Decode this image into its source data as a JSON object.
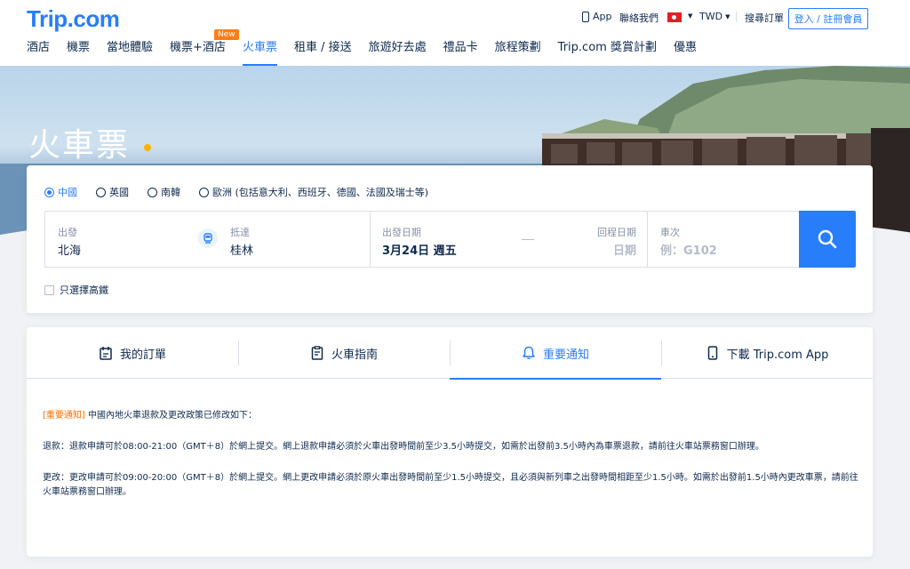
{
  "header": {
    "logo": "Trip.com",
    "app_label": "App",
    "contact_label": "聯絡我們",
    "currency": "TWD",
    "orders_label": "搜尋訂單",
    "login_label": "登入 / 註冊會員"
  },
  "nav": {
    "items": [
      "酒店",
      "機票",
      "當地體驗",
      "機票+酒店",
      "火車票",
      "租車 / 接送",
      "旅遊好去處",
      "禮品卡",
      "旅程策劃",
      "Trip.com 獎賞計劃",
      "優惠"
    ],
    "active": "火車票",
    "new_badge": "New"
  },
  "hero": {
    "title": "火車票"
  },
  "search": {
    "regions": [
      "中國",
      "英國",
      "南韓",
      "歐洲 (包括意大利、西班牙、德國、法國及瑞士等)"
    ],
    "selected_region": "中國",
    "from_label": "出發",
    "from_value": "北海",
    "to_label": "抵達",
    "to_value": "桂林",
    "depart_label": "出發日期",
    "depart_value": "3月24日 週五",
    "return_label": "回程日期",
    "return_value": "日期",
    "train_label": "車次",
    "train_placeholder": "例：G102",
    "hs_only_label": "只選擇高鐵"
  },
  "tabs": {
    "items": [
      "我的訂單",
      "火車指南",
      "重要通知",
      "下載 Trip.com App"
    ],
    "active": "重要通知"
  },
  "notice": {
    "tag": "[重要通知]",
    "intro": " 中國內地火車退款及更改政策已修改如下：",
    "refund": "退款：退款申請可於08:00-21:00（GMT＋8）於網上提交。網上退款申請必須於火車出發時間前至少3.5小時提交，如需於出發前3.5小時內為車票退款，請前往火車站票務窗口辦理。",
    "change": "更改：更改申請可於09:00-20:00（GMT＋8）於網上提交。網上更改申請必須於原火車出發時間前至少1.5小時提交，且必須與新列車之出發時間相距至少1.5小時。如需於出發前1.5小時內更改車票，請前往火車站票務窗口辦理。"
  },
  "colors": {
    "brand": "#287dfa",
    "accent": "#ffb400",
    "notice_tag": "#ff6f00",
    "text": "#0f294d"
  }
}
